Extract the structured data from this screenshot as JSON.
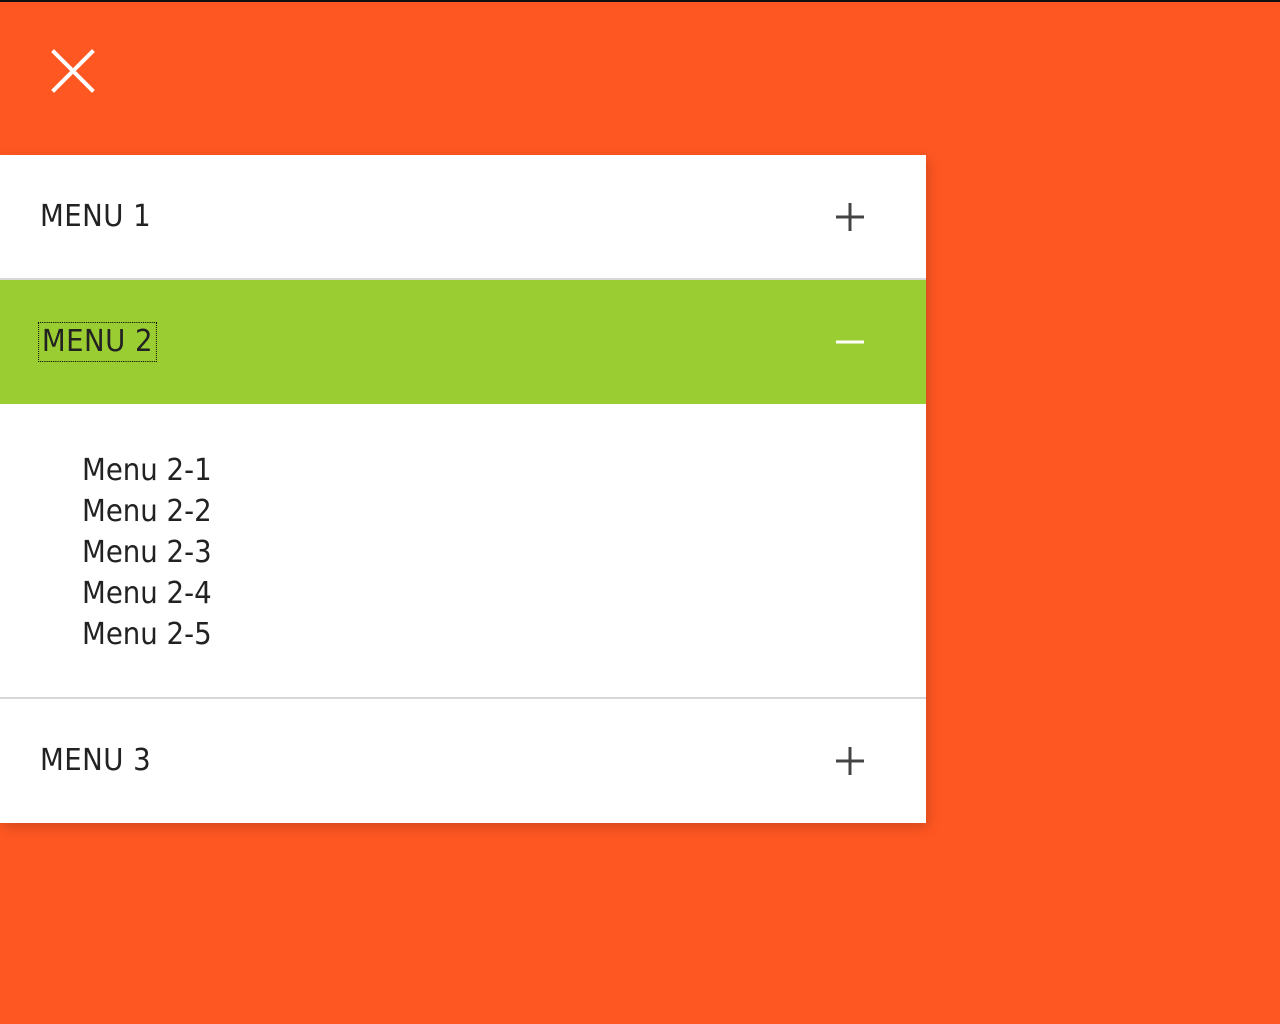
{
  "colors": {
    "background": "#ff5722",
    "panel": "#ffffff",
    "active_header": "#9acd32",
    "text": "#222222"
  },
  "close": {
    "icon": "close-icon"
  },
  "menus": [
    {
      "label": "MENU 1",
      "toggle_icon": "plus-icon",
      "expanded": false
    },
    {
      "label": "MENU 2",
      "toggle_icon": "minus-icon",
      "expanded": true,
      "items": [
        "Menu 2-1",
        "Menu 2-2",
        "Menu 2-3",
        "Menu 2-4",
        "Menu 2-5"
      ]
    },
    {
      "label": "MENU 3",
      "toggle_icon": "plus-icon",
      "expanded": false
    }
  ]
}
